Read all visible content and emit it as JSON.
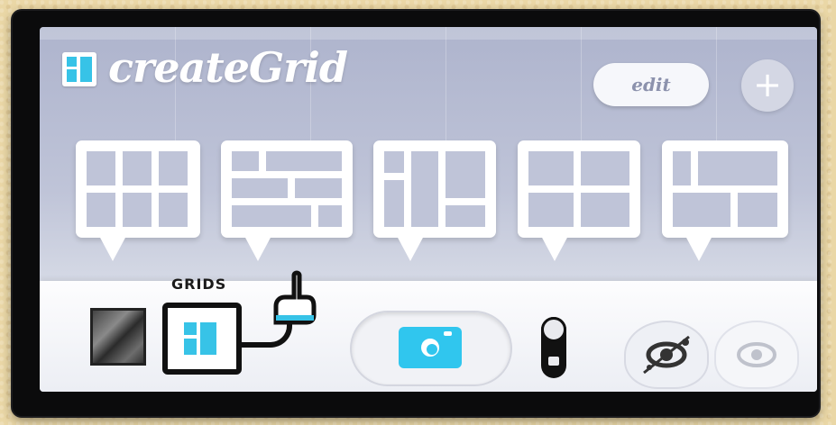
{
  "header": {
    "app_title": "createGrid",
    "edit_label": "edit",
    "add_label": "+"
  },
  "layouts": [
    {
      "name": "3x2 grid"
    },
    {
      "name": "brick grid"
    },
    {
      "name": "column grid"
    },
    {
      "name": "2x2 grid"
    },
    {
      "name": "mixed grid"
    }
  ],
  "toolbar": {
    "grids_label": "GRIDS",
    "icons": [
      "photo-thumbnail",
      "grids-icon",
      "pointer-hand-icon",
      "camera-icon",
      "3d-toggle-icon",
      "3d-view-icon",
      "eye-icon"
    ]
  },
  "colors": {
    "accent": "#37c3e7",
    "screen_bg": "#bfc4d8",
    "card": "#ffffff",
    "outline": "#111111"
  }
}
